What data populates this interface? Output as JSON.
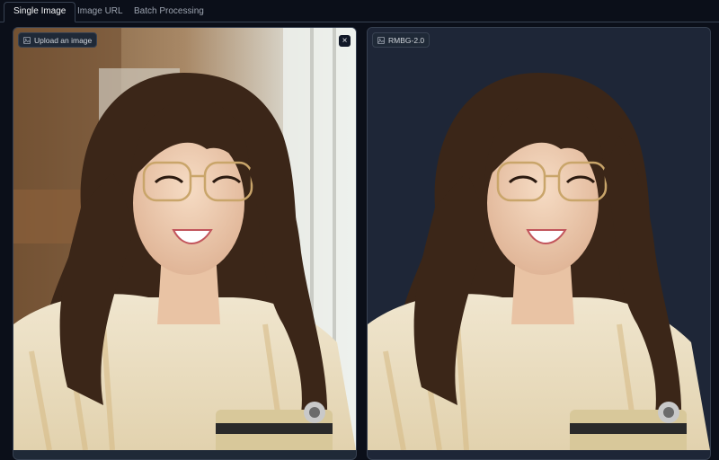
{
  "tabs": [
    {
      "label": "Single Image",
      "active": true
    },
    {
      "label": "Image URL",
      "active": false
    },
    {
      "label": "Batch Processing",
      "active": false
    }
  ],
  "input_panel": {
    "label": "Upload an image",
    "label_icon": "image-icon",
    "close_icon": "close-icon",
    "close_symbol": "×"
  },
  "output_panel": {
    "label": "RMBG-2.0",
    "label_icon": "image-icon"
  },
  "colors": {
    "page_bg": "#0b0f19",
    "panel_bg": "#1f2937",
    "output_bg": "#1e2637",
    "border": "#374151"
  }
}
